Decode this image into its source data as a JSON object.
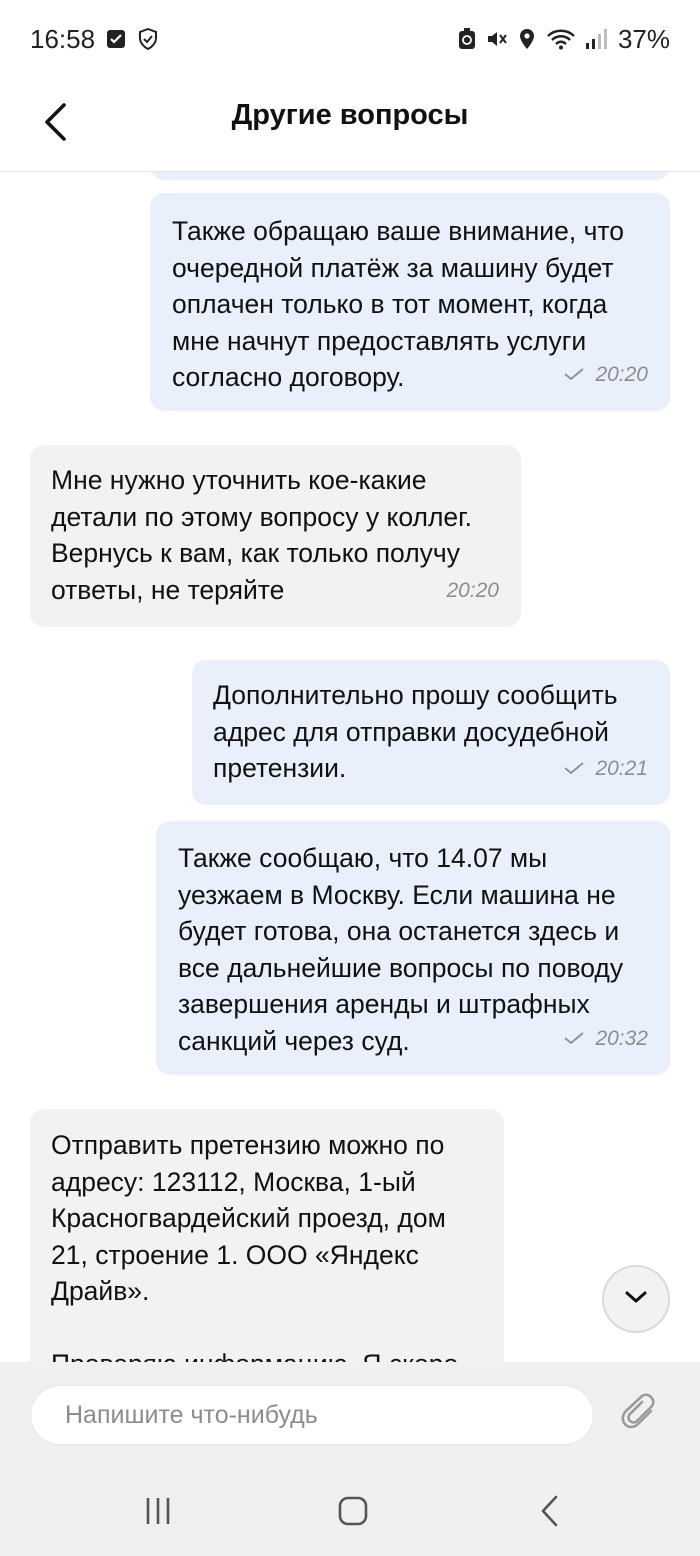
{
  "status_bar": {
    "time": "16:58",
    "battery": "37%",
    "icons_left": [
      "checkbox-icon",
      "shield-icon"
    ],
    "icons_right": [
      "battery-saver-icon",
      "mute-icon",
      "location-icon",
      "wifi-icon",
      "signal-icon"
    ]
  },
  "header": {
    "title": "Другие вопросы",
    "back_icon": "chevron-left-icon"
  },
  "messages": [
    {
      "direction": "outgoing",
      "text": "Также обращаю ваше внимание, что\nочередной платёж за машину будет\nоплачен только в тот момент, когда\nмне начнут предоставлять услуги\nсогласно договору.",
      "time": "20:20",
      "status_icon": "check-icon"
    },
    {
      "direction": "incoming",
      "text": "Мне нужно уточнить кое-какие\nдетали по этому вопросу у коллег.\nВернусь к вам, как только получу\nответы, не теряйте",
      "time": "20:20"
    },
    {
      "direction": "outgoing",
      "text": "Дополнительно прошу сообщить\nадрес для отправки досудебной\nпретензии.",
      "time": "20:21",
      "status_icon": "check-icon"
    },
    {
      "direction": "outgoing",
      "text": "Также сообщаю, что 14.07 мы\nуезжаем в Москву. Если машина не\nбудет готова, она останется здесь и\nвсе дальнейшие вопросы по поводу\nзавершения аренды и штрафных\nсанкций через суд.",
      "time": "20:32",
      "status_icon": "check-icon"
    },
    {
      "direction": "incoming",
      "text": "Отправить претензию можно по\nадресу: 123112, Москва, 1-ый\nКрасногвардейский проезд, дом\n21, строение 1. ООО «Яндекс\nДрайв».\n\nПроверяю информацию. Я скоро"
    }
  ],
  "scroll_down_icon": "chevron-down-icon",
  "composer": {
    "placeholder": "Напишите что-нибудь",
    "value": "",
    "attach_icon": "paperclip-icon"
  },
  "nav_bar": {
    "icons": [
      "recent-apps-icon",
      "home-icon",
      "back-icon"
    ]
  },
  "colors": {
    "outgoing_bubble": "#e9f0fc",
    "incoming_bubble": "#f2f2f2",
    "meta_text": "#8e8e8e",
    "composer_bg": "#f0f0f0"
  }
}
